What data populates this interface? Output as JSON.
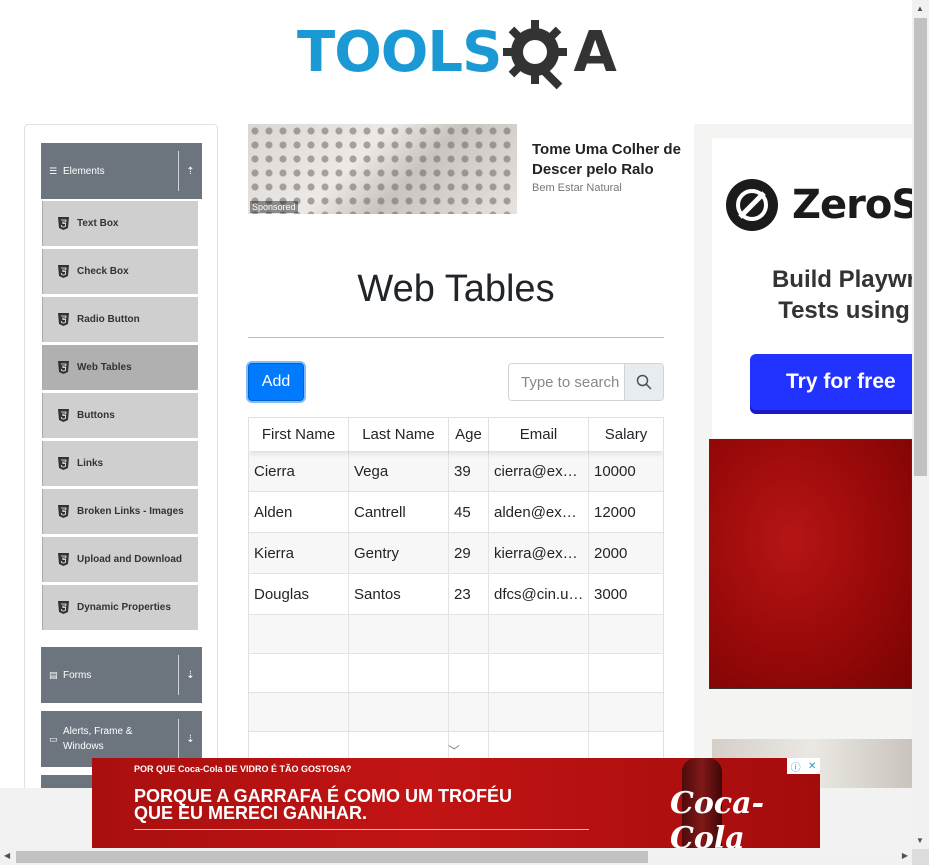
{
  "header": {
    "logo_text": "TOOLS",
    "logo_suffix": "A"
  },
  "sidebar": {
    "groups": [
      {
        "label": "Elements",
        "icon": "list-icon",
        "arrow": "up"
      },
      {
        "label": "Forms",
        "icon": "form-icon",
        "arrow": "down"
      },
      {
        "label": "Alerts, Frame & Windows",
        "icon": "window-icon",
        "arrow": "down"
      }
    ],
    "items": [
      {
        "label": "Text Box"
      },
      {
        "label": "Check Box"
      },
      {
        "label": "Radio Button"
      },
      {
        "label": "Web Tables",
        "active": true
      },
      {
        "label": "Buttons"
      },
      {
        "label": "Links"
      },
      {
        "label": "Broken Links - Images"
      },
      {
        "label": "Upload and Download"
      },
      {
        "label": "Dynamic Properties"
      }
    ]
  },
  "ad_top": {
    "title": "Tome Uma Colher de Descer pelo Ralo",
    "source": "Bem Estar Natural",
    "sponsored": "Sponsored"
  },
  "main": {
    "title": "Web Tables",
    "add_label": "Add",
    "search_placeholder": "Type to search"
  },
  "table": {
    "headers": [
      "First Name",
      "Last Name",
      "Age",
      "Email",
      "Salary"
    ],
    "rows": [
      [
        "Cierra",
        "Vega",
        "39",
        "cierra@ex…",
        "10000"
      ],
      [
        "Alden",
        "Cantrell",
        "45",
        "alden@ex…",
        "12000"
      ],
      [
        "Kierra",
        "Gentry",
        "29",
        "kierra@ex…",
        "2000"
      ],
      [
        "Douglas",
        "Santos",
        "23",
        "dfcs@cin.u…",
        "3000"
      ]
    ]
  },
  "ad_right": {
    "brand": "ZeroS",
    "line1": "Build Playwr",
    "line2": "Tests using",
    "cta": "Try for free"
  },
  "ad_bottom": {
    "small": "POR QUE Coca-Cola DE VIDRO É TÃO GOSTOSA?",
    "line1": "PORQUE A GARRAFA É COMO UM TROFÉU",
    "line2": "QUE EU MERECI GANHAR.",
    "brand": "Coca-Cola"
  },
  "colors": {
    "accent": "#007bff",
    "brand_blue": "#1a99d4",
    "sidebar_header": "#6c757d"
  }
}
